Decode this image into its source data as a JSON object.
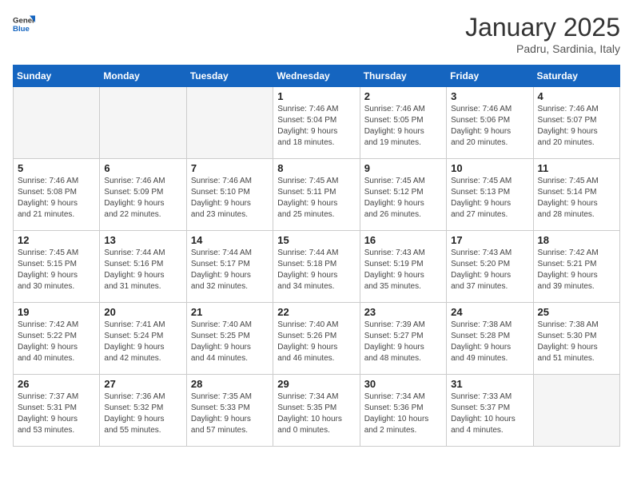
{
  "logo": {
    "general": "General",
    "blue": "Blue"
  },
  "header": {
    "month": "January 2025",
    "location": "Padru, Sardinia, Italy"
  },
  "weekdays": [
    "Sunday",
    "Monday",
    "Tuesday",
    "Wednesday",
    "Thursday",
    "Friday",
    "Saturday"
  ],
  "weeks": [
    [
      {
        "num": "",
        "info": "",
        "empty": true
      },
      {
        "num": "",
        "info": "",
        "empty": true
      },
      {
        "num": "",
        "info": "",
        "empty": true
      },
      {
        "num": "1",
        "info": "Sunrise: 7:46 AM\nSunset: 5:04 PM\nDaylight: 9 hours\nand 18 minutes."
      },
      {
        "num": "2",
        "info": "Sunrise: 7:46 AM\nSunset: 5:05 PM\nDaylight: 9 hours\nand 19 minutes."
      },
      {
        "num": "3",
        "info": "Sunrise: 7:46 AM\nSunset: 5:06 PM\nDaylight: 9 hours\nand 20 minutes."
      },
      {
        "num": "4",
        "info": "Sunrise: 7:46 AM\nSunset: 5:07 PM\nDaylight: 9 hours\nand 20 minutes."
      }
    ],
    [
      {
        "num": "5",
        "info": "Sunrise: 7:46 AM\nSunset: 5:08 PM\nDaylight: 9 hours\nand 21 minutes."
      },
      {
        "num": "6",
        "info": "Sunrise: 7:46 AM\nSunset: 5:09 PM\nDaylight: 9 hours\nand 22 minutes."
      },
      {
        "num": "7",
        "info": "Sunrise: 7:46 AM\nSunset: 5:10 PM\nDaylight: 9 hours\nand 23 minutes."
      },
      {
        "num": "8",
        "info": "Sunrise: 7:45 AM\nSunset: 5:11 PM\nDaylight: 9 hours\nand 25 minutes."
      },
      {
        "num": "9",
        "info": "Sunrise: 7:45 AM\nSunset: 5:12 PM\nDaylight: 9 hours\nand 26 minutes."
      },
      {
        "num": "10",
        "info": "Sunrise: 7:45 AM\nSunset: 5:13 PM\nDaylight: 9 hours\nand 27 minutes."
      },
      {
        "num": "11",
        "info": "Sunrise: 7:45 AM\nSunset: 5:14 PM\nDaylight: 9 hours\nand 28 minutes."
      }
    ],
    [
      {
        "num": "12",
        "info": "Sunrise: 7:45 AM\nSunset: 5:15 PM\nDaylight: 9 hours\nand 30 minutes."
      },
      {
        "num": "13",
        "info": "Sunrise: 7:44 AM\nSunset: 5:16 PM\nDaylight: 9 hours\nand 31 minutes."
      },
      {
        "num": "14",
        "info": "Sunrise: 7:44 AM\nSunset: 5:17 PM\nDaylight: 9 hours\nand 32 minutes."
      },
      {
        "num": "15",
        "info": "Sunrise: 7:44 AM\nSunset: 5:18 PM\nDaylight: 9 hours\nand 34 minutes."
      },
      {
        "num": "16",
        "info": "Sunrise: 7:43 AM\nSunset: 5:19 PM\nDaylight: 9 hours\nand 35 minutes."
      },
      {
        "num": "17",
        "info": "Sunrise: 7:43 AM\nSunset: 5:20 PM\nDaylight: 9 hours\nand 37 minutes."
      },
      {
        "num": "18",
        "info": "Sunrise: 7:42 AM\nSunset: 5:21 PM\nDaylight: 9 hours\nand 39 minutes."
      }
    ],
    [
      {
        "num": "19",
        "info": "Sunrise: 7:42 AM\nSunset: 5:22 PM\nDaylight: 9 hours\nand 40 minutes."
      },
      {
        "num": "20",
        "info": "Sunrise: 7:41 AM\nSunset: 5:24 PM\nDaylight: 9 hours\nand 42 minutes."
      },
      {
        "num": "21",
        "info": "Sunrise: 7:40 AM\nSunset: 5:25 PM\nDaylight: 9 hours\nand 44 minutes."
      },
      {
        "num": "22",
        "info": "Sunrise: 7:40 AM\nSunset: 5:26 PM\nDaylight: 9 hours\nand 46 minutes."
      },
      {
        "num": "23",
        "info": "Sunrise: 7:39 AM\nSunset: 5:27 PM\nDaylight: 9 hours\nand 48 minutes."
      },
      {
        "num": "24",
        "info": "Sunrise: 7:38 AM\nSunset: 5:28 PM\nDaylight: 9 hours\nand 49 minutes."
      },
      {
        "num": "25",
        "info": "Sunrise: 7:38 AM\nSunset: 5:30 PM\nDaylight: 9 hours\nand 51 minutes."
      }
    ],
    [
      {
        "num": "26",
        "info": "Sunrise: 7:37 AM\nSunset: 5:31 PM\nDaylight: 9 hours\nand 53 minutes."
      },
      {
        "num": "27",
        "info": "Sunrise: 7:36 AM\nSunset: 5:32 PM\nDaylight: 9 hours\nand 55 minutes."
      },
      {
        "num": "28",
        "info": "Sunrise: 7:35 AM\nSunset: 5:33 PM\nDaylight: 9 hours\nand 57 minutes."
      },
      {
        "num": "29",
        "info": "Sunrise: 7:34 AM\nSunset: 5:35 PM\nDaylight: 10 hours\nand 0 minutes."
      },
      {
        "num": "30",
        "info": "Sunrise: 7:34 AM\nSunset: 5:36 PM\nDaylight: 10 hours\nand 2 minutes."
      },
      {
        "num": "31",
        "info": "Sunrise: 7:33 AM\nSunset: 5:37 PM\nDaylight: 10 hours\nand 4 minutes."
      },
      {
        "num": "",
        "info": "",
        "empty": true
      }
    ]
  ]
}
